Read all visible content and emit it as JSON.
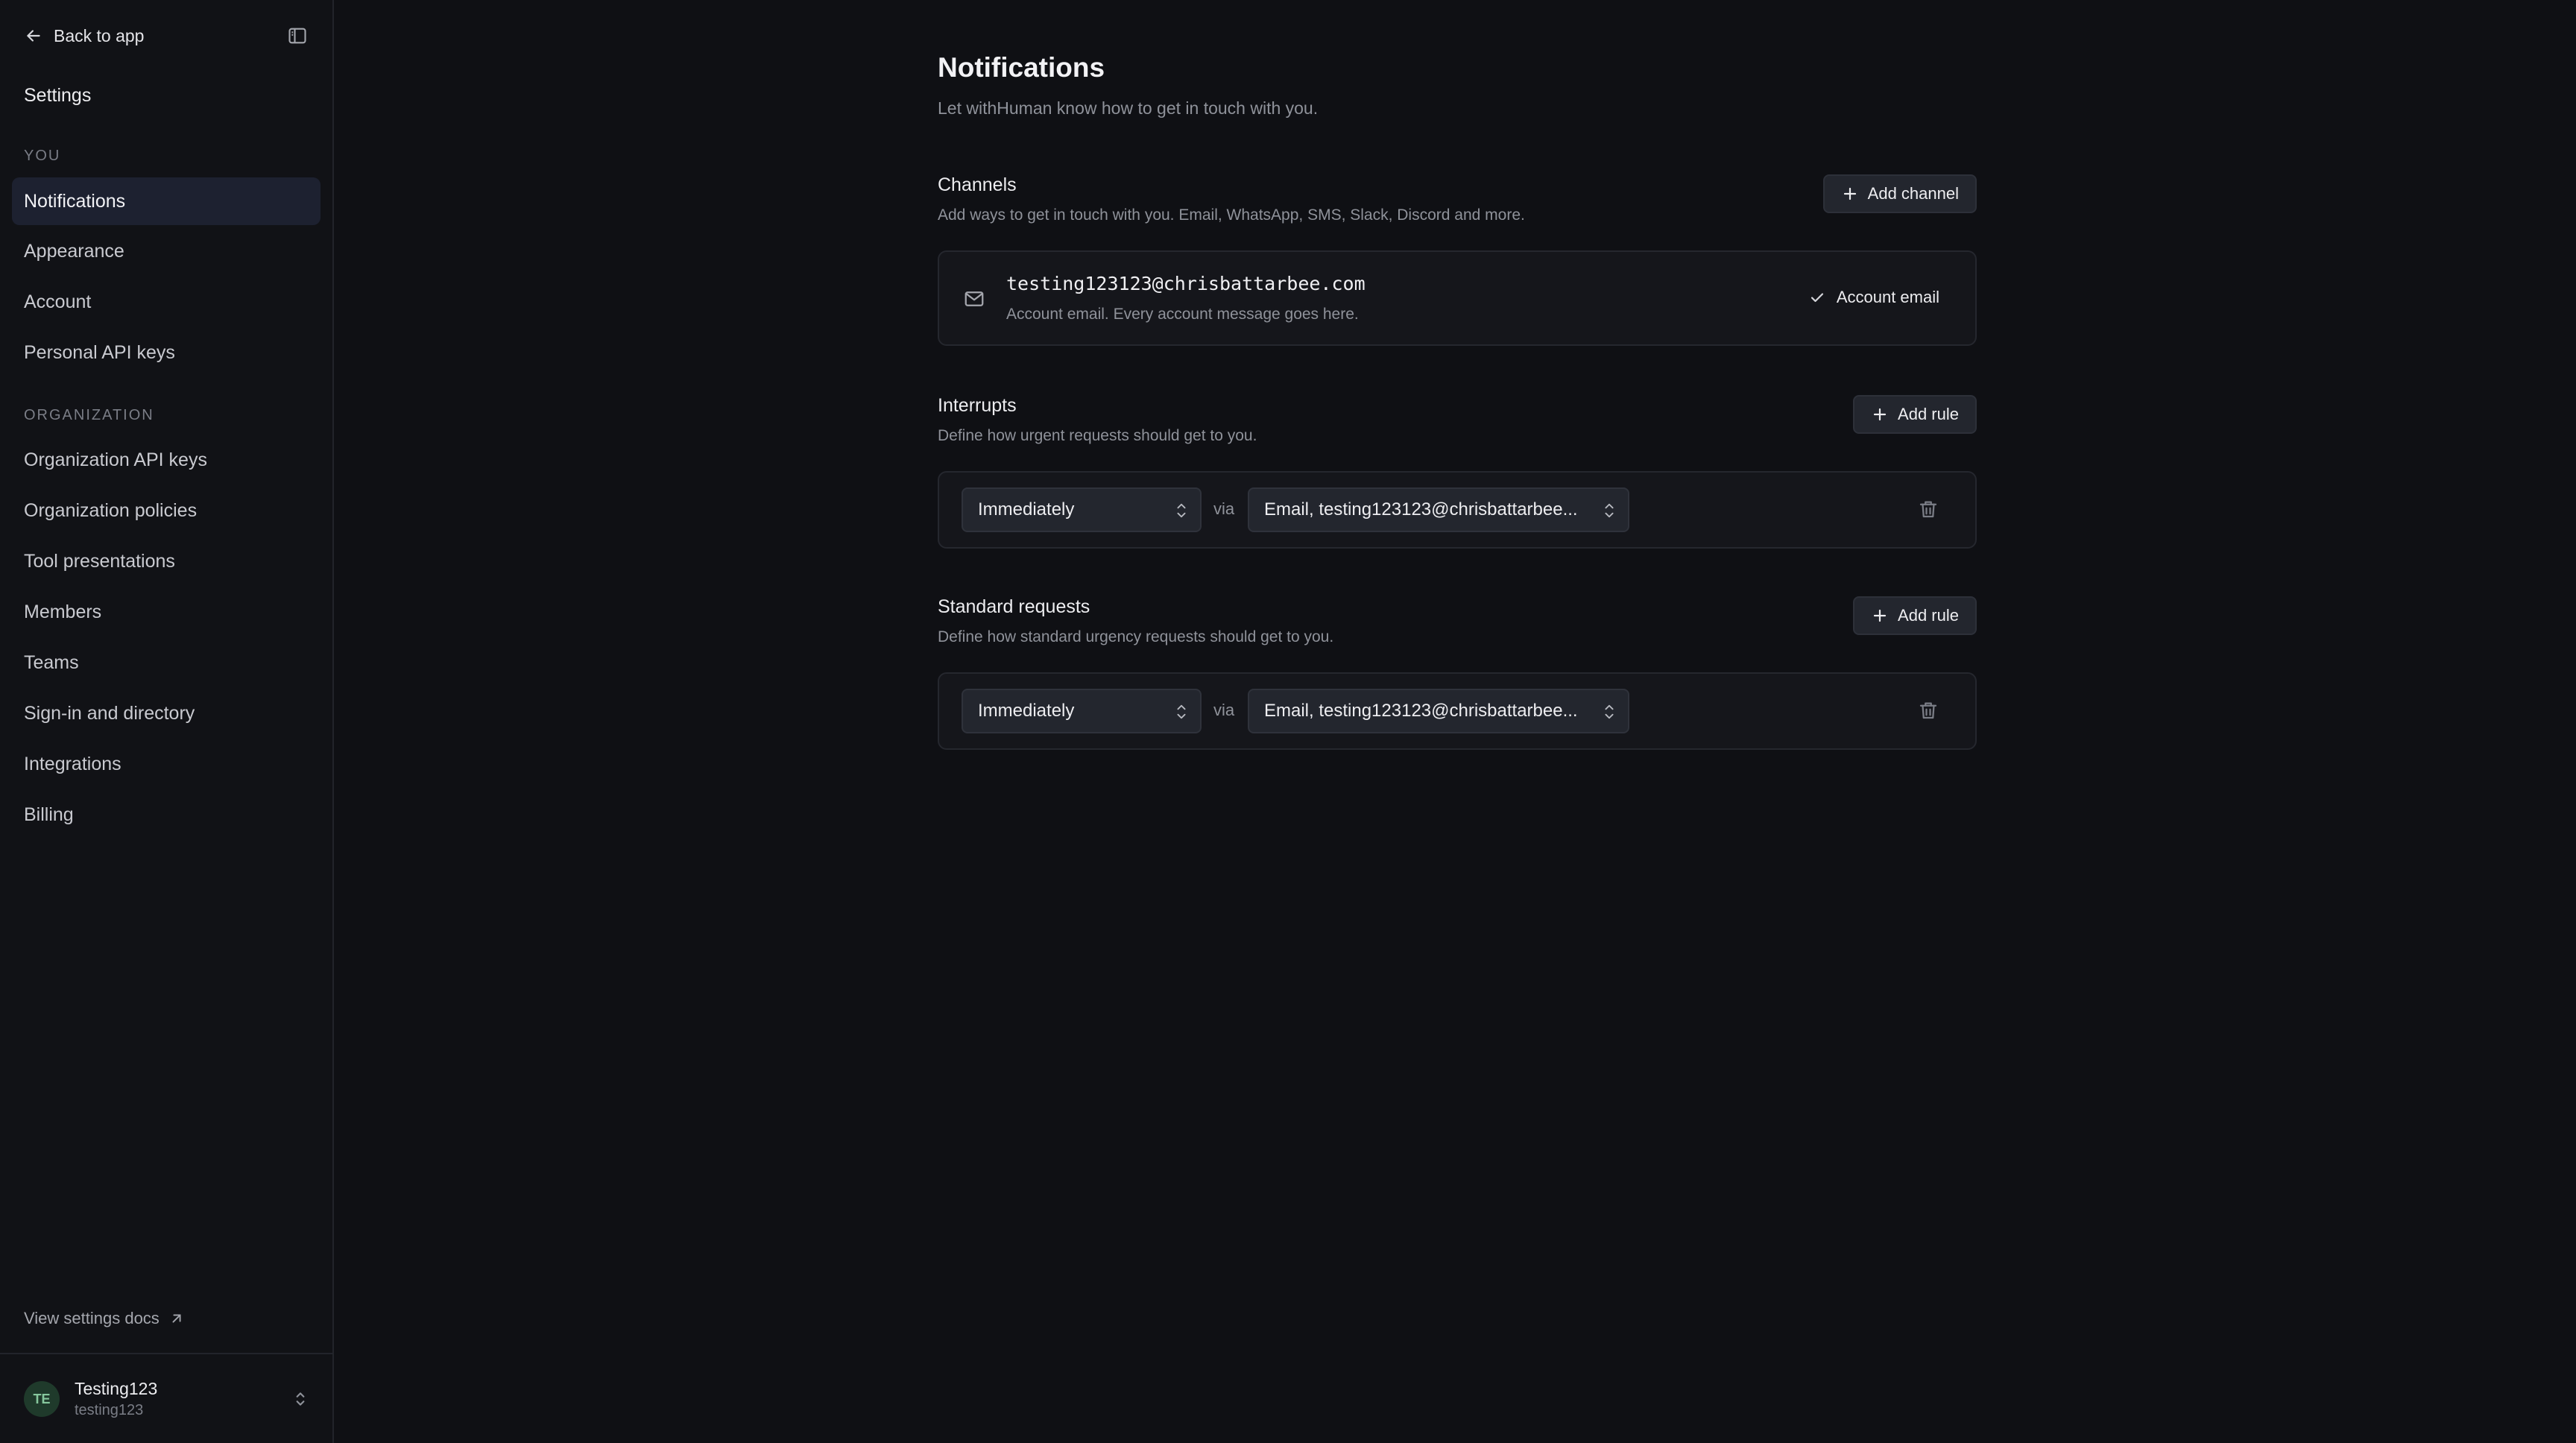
{
  "sidebar": {
    "back_label": "Back to app",
    "title": "Settings",
    "you_section": "YOU",
    "you_items": [
      {
        "label": "Notifications",
        "active": true
      },
      {
        "label": "Appearance"
      },
      {
        "label": "Account"
      },
      {
        "label": "Personal API keys"
      }
    ],
    "org_section": "ORGANIZATION",
    "org_items": [
      {
        "label": "Organization API keys"
      },
      {
        "label": "Organization policies"
      },
      {
        "label": "Tool presentations"
      },
      {
        "label": "Members"
      },
      {
        "label": "Teams"
      },
      {
        "label": "Sign-in and directory"
      },
      {
        "label": "Integrations"
      },
      {
        "label": "Billing"
      }
    ],
    "docs_label": "View settings docs",
    "user": {
      "initials": "TE",
      "name": "Testing123",
      "handle": "testing123"
    }
  },
  "main": {
    "title": "Notifications",
    "subtitle": "Let withHuman know how to get in touch with you.",
    "channels": {
      "title": "Channels",
      "description": "Add ways to get in touch with you. Email, WhatsApp, SMS, Slack, Discord and more.",
      "button": "Add channel",
      "email": "testing123123@chrisbattarbee.com",
      "email_desc": "Account email. Every account message goes here.",
      "tag": "Account email"
    },
    "interrupts": {
      "title": "Interrupts",
      "description": "Define how urgent requests should get to you.",
      "button": "Add rule",
      "when": "Immediately",
      "via_label": "via",
      "channel": "Email, testing123123@chrisbattarbee..."
    },
    "standard": {
      "title": "Standard requests",
      "description": "Define how standard urgency requests should get to you.",
      "button": "Add rule",
      "when": "Immediately",
      "via_label": "via",
      "channel": "Email, testing123123@chrisbattarbee..."
    }
  },
  "colors": {
    "background": "#0f1014",
    "sidebar": "#111216",
    "active_item": "#1d2130",
    "card": "#15161b",
    "control": "#23262e"
  }
}
